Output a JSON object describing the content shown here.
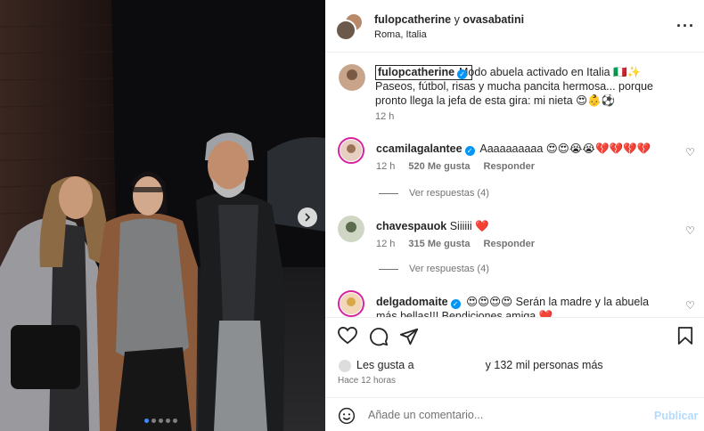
{
  "post": {
    "photo_alt": "",
    "carousel": {
      "total": 5,
      "active": 0
    }
  },
  "header": {
    "user1": "fulopcatherine",
    "joiner": "y",
    "user2": "ovasabatini",
    "location": "Roma, Italia",
    "more_icon": "more-horizontal-icon"
  },
  "caption": {
    "username": "fulopcatherine",
    "text1": "Modo abuela activado en Italia 🇮🇹✨",
    "text2": "Paseos, fútbol, risas y mucha pancita hermosa... porque pronto llega la jefa de esta gira: mi nieta 😍👶⚽",
    "time": "12 h"
  },
  "comments": [
    {
      "username": "ccamilagalantee",
      "verified": true,
      "text": "Aaaaaaaaaa 😍😍😭😭💔💔💔💔",
      "time": "12 h",
      "likes": "520 Me gusta",
      "reply": "Responder",
      "view_replies": "Ver respuestas (4)"
    },
    {
      "username": "chavespauok",
      "verified": false,
      "text": "Siiiiii ❤️",
      "time": "12 h",
      "likes": "315 Me gusta",
      "reply": "Responder",
      "view_replies": "Ver respuestas (4)"
    },
    {
      "username": "delgadomaite",
      "verified": true,
      "text": "😍😍😍😍 Serán la madre y la abuela más bellas!!! Bendiciones amiga ❤️"
    }
  ],
  "actions": {
    "like_icon": "heart-icon",
    "comment_icon": "comment-icon",
    "share_icon": "send-icon",
    "save_icon": "bookmark-icon",
    "likes_prefix": "Les gusta a",
    "likes_suffix": "y 132 mil personas más",
    "posted_ago": "Hace 12 horas"
  },
  "composer": {
    "placeholder": "Añade un comentario...",
    "publish_label": "Publicar"
  },
  "colors": {
    "verified": "#0095f6",
    "publish_disabled": "#b3dbff",
    "heart": "#e0245e"
  }
}
